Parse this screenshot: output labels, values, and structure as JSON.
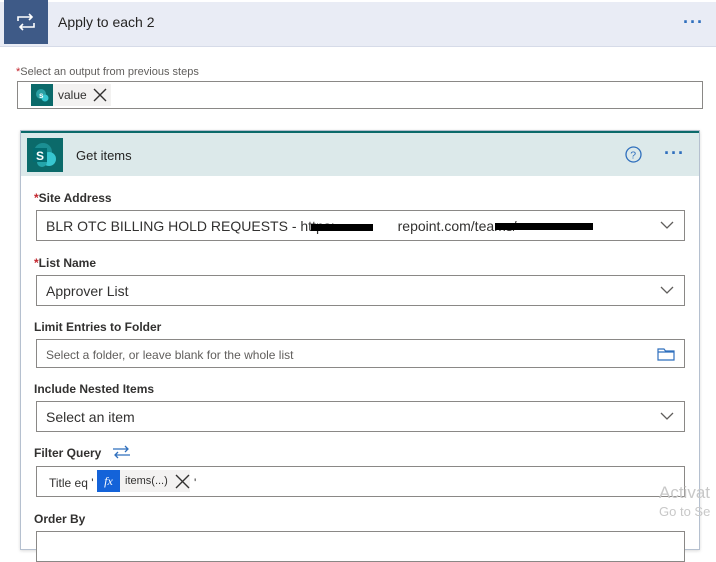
{
  "apply_each": {
    "title": "Apply to each 2",
    "select_label": "Select an output from previous steps",
    "token_value": "value"
  },
  "get_items": {
    "title": "Get items",
    "help_icon": "question-circle-icon",
    "fields": {
      "site_address": {
        "label": "Site Address",
        "value_prefix": "BLR OTC BILLING HOLD REQUESTS - https:",
        "value_mid": "repoint.com/teams/"
      },
      "list_name": {
        "label": "List Name",
        "value": "Approver List"
      },
      "limit_folder": {
        "label": "Limit Entries to Folder",
        "placeholder": "Select a folder, or leave blank for the whole list"
      },
      "nested_items": {
        "label": "Include Nested Items",
        "value": "Select an item"
      },
      "filter_query": {
        "label": "Filter Query",
        "prefix": "Title eq '",
        "fx_label": "fx",
        "token": "items(...)",
        "suffix": "'"
      },
      "order_by": {
        "label": "Order By"
      }
    }
  },
  "watermark": {
    "line1": "Activat",
    "line2": "Go to Se"
  },
  "colors": {
    "sharepoint": "#0b6a6a",
    "apply_icon_bg": "#3e5a87",
    "accent": "#2f6fbd",
    "fx_bg": "#1463d9"
  }
}
